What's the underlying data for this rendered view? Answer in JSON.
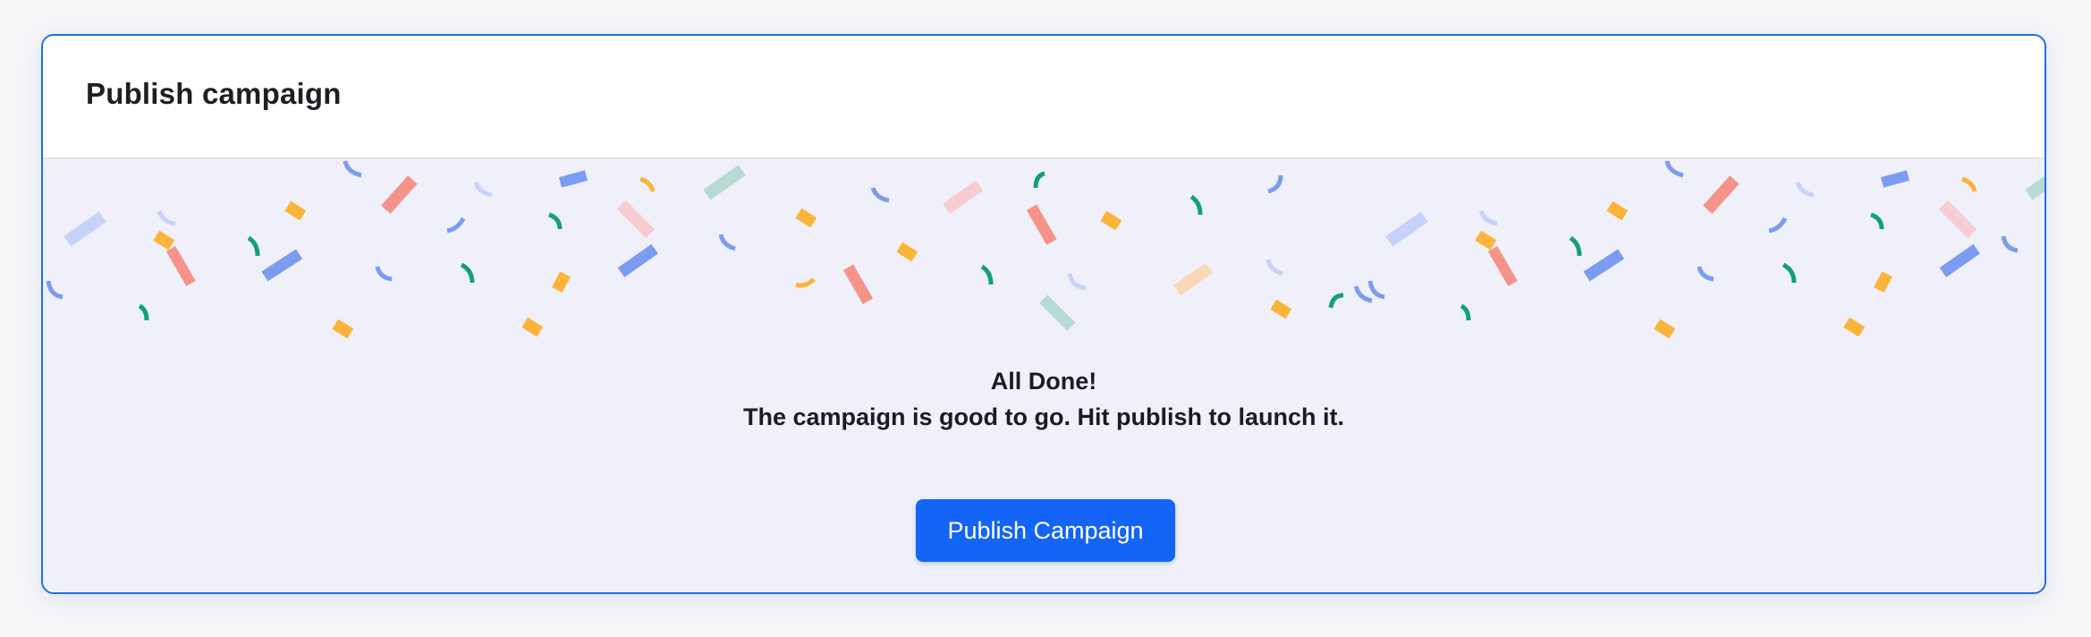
{
  "card": {
    "title": "Publish campaign"
  },
  "message": {
    "headline": "All Done!",
    "subline": "The campaign is good to go. Hit publish to launch it."
  },
  "actions": {
    "publish_label": "Publish Campaign"
  },
  "colors": {
    "accent": "#1464f6",
    "card_border": "#1f6fe6",
    "body_background": "#f0f0fa",
    "confetti": [
      "#7b9cf0",
      "#f5938a",
      "#fbb33a",
      "#12a077",
      "#c7d2fa",
      "#f7ccd2",
      "#b7dad3",
      "#fad8b8"
    ]
  },
  "icons": {
    "decoration": "confetti-pattern"
  }
}
